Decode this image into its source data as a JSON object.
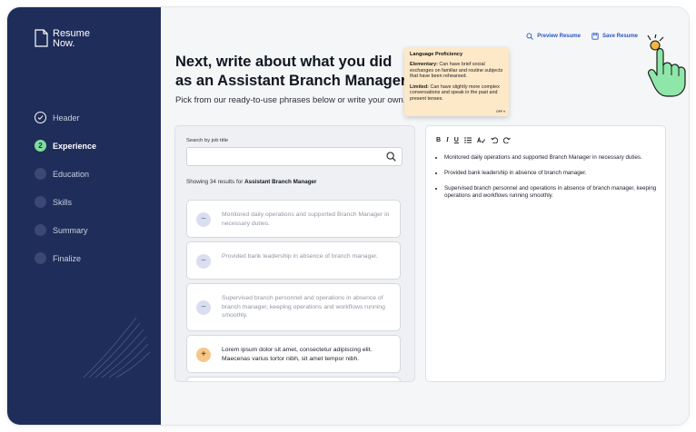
{
  "brand": {
    "line1": "Resume",
    "line2": "Now."
  },
  "steps": [
    {
      "label": "Header",
      "state": "done"
    },
    {
      "label": "Experience",
      "state": "active",
      "number": "2"
    },
    {
      "label": "Education",
      "state": "pending"
    },
    {
      "label": "Skills",
      "state": "pending"
    },
    {
      "label": "Summary",
      "state": "pending"
    },
    {
      "label": "Finalize",
      "state": "pending"
    }
  ],
  "topbar": {
    "preview_label": "Preview Resume",
    "save_label": "Save Resume"
  },
  "heading": {
    "line1": "Next, write about what you did",
    "line2": "as an Assistant Branch Manager",
    "subtitle": "Pick from our ready-to-use phrases below or write your own."
  },
  "search": {
    "label": "Search by job title",
    "value": "",
    "placeholder": ""
  },
  "results": {
    "prefix": "Showing 34 results for ",
    "query": "Assistant Branch Manager"
  },
  "phrases": [
    {
      "text": "Monitored daily operations and supported Branch Manager in necessary duties.",
      "added": true
    },
    {
      "text": "Provided bank leadership in absence of branch manager.",
      "added": true
    },
    {
      "text": "Supervised branch personnel and operations in absence of branch manager, keeping operations and workflows running smoothly.",
      "added": true
    },
    {
      "text": "Lorem ipsum dolor sit amet, consectetur adipiscing elit. Maecenas varius tortor nibh, sit amet tempor nibh.",
      "added": false
    }
  ],
  "editor": {
    "toolbar": [
      "B",
      "I",
      "U",
      "list",
      "spell",
      "undo",
      "redo"
    ],
    "bullets": [
      "Monitored daily operations and supported Branch Manager in necessary duties.",
      "Provided bank leadership in absence of branch manager.",
      "Supervised branch personnel and operations in absence of branch manager, keeping operations and workflows running smoothly."
    ]
  },
  "tooltip": {
    "title": "Language Proficiency",
    "elementary_label": "Elementary:",
    "elementary_text": " Can have brief social exchanges on familiar and routine subjects that have been rehearsed.",
    "limited_label": "Limited:",
    "limited_text": " Can have slightly more complex conversations and speak in the past and present tenses.",
    "off": "OFF"
  },
  "colors": {
    "sidebar": "#1f2d5a",
    "active_step": "#7fdd9c",
    "accent_link": "#2a55c4",
    "tooltip_bg": "#fde8c8",
    "hand": "#8ee6a8"
  }
}
